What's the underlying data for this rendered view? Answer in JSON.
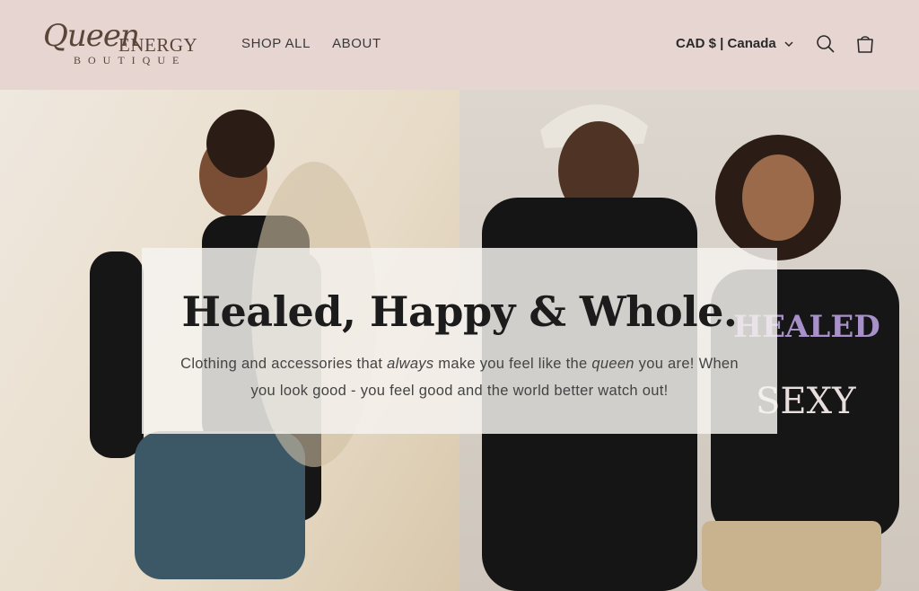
{
  "header": {
    "logo": {
      "script": "Queen",
      "word": "ENERGY",
      "sub": "BOUTIQUE"
    },
    "nav": [
      {
        "label": "SHOP ALL"
      },
      {
        "label": "ABOUT"
      }
    ],
    "currency": "CAD $ | Canada",
    "icons": {
      "search": "search-icon",
      "cart": "cart-icon",
      "chevron": "chevron-down-icon"
    }
  },
  "hero": {
    "title": "Healed, Happy & Whole.",
    "desc_part1": "Clothing and accessories that ",
    "desc_em1": "always",
    "desc_part2": " make you feel like the ",
    "desc_em2": "queen",
    "desc_part3": " you are! When you look good - you feel good and the world better watch out!"
  },
  "colors": {
    "header_bg": "#e7d5d2",
    "text_dark": "#1c1c1c",
    "logo": "#5b4438"
  }
}
